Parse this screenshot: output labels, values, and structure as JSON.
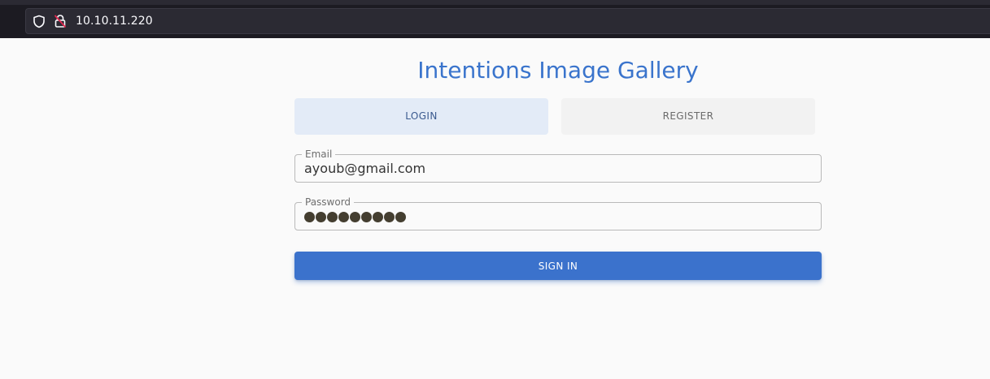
{
  "browser": {
    "url": "10.10.11.220",
    "colors": {
      "chrome_bg": "#1c1b22",
      "urlbar_bg": "#2b2a33"
    }
  },
  "page": {
    "title": "Intentions Image Gallery",
    "tabs": [
      {
        "label": "LOGIN",
        "active": true
      },
      {
        "label": "REGISTER",
        "active": false
      }
    ],
    "form": {
      "email": {
        "label": "Email",
        "value": "ayoub@gmail.com"
      },
      "password": {
        "label": "Password",
        "masked_length": 9
      },
      "submit_label": "SIGN IN"
    },
    "colors": {
      "accent": "#3b72cc",
      "title": "#3a74cc",
      "active_tab_bg": "#e3ebf7",
      "inactive_tab_bg": "#f2f2f2",
      "background": "#fafafa"
    }
  }
}
